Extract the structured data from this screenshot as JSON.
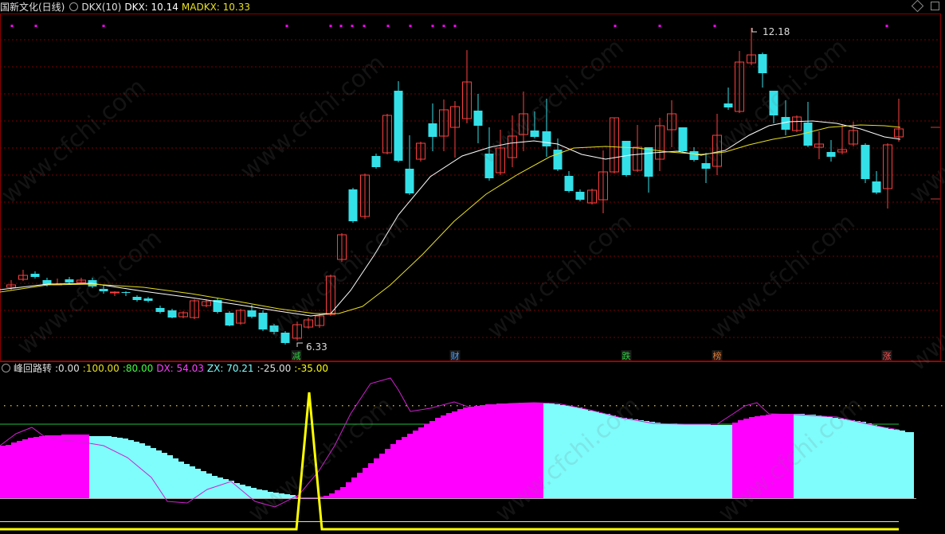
{
  "header": {
    "stock_name": "国新文化(日线)",
    "indicator_name": "DKX(10)",
    "dkx_label": "DKX: 10.14",
    "madkx_label": "MADKX: 10.33"
  },
  "indicator_header": {
    "name": "峰回路转",
    "values": [
      ":0.00",
      ":100.00",
      ":80.00",
      "DX: 54.03",
      "ZX: 70.21",
      ":-25.00",
      ":-35.00"
    ]
  },
  "price_annotations": {
    "high": "12.18",
    "low": "6.33"
  },
  "event_markers": [
    {
      "label": "减",
      "color": "#2ecc40"
    },
    {
      "label": "财",
      "color": "#4aa0ff"
    },
    {
      "label": "跌",
      "color": "#2ecc40"
    },
    {
      "label": "榜",
      "color": "#e07830"
    },
    {
      "label": "涨",
      "color": "#ff5050"
    }
  ],
  "watermark": "www.cfchi.com",
  "colors": {
    "up": "#ff4040",
    "down": "#33e0e8",
    "dkx": "#ffffff",
    "madkx": "#e8e020",
    "magenta": "#ff00ff",
    "cyan_fill": "#7ffcfc",
    "yellow_line": "#ffff00"
  }
}
